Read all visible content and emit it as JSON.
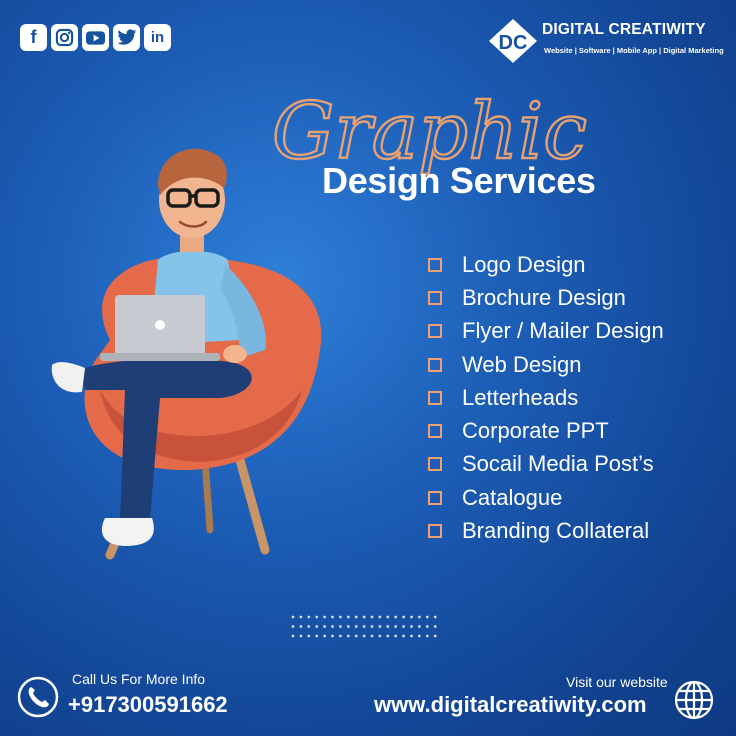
{
  "socials": [
    {
      "icon": "facebook-icon",
      "glyph": "f"
    },
    {
      "icon": "instagram-icon",
      "glyph": ""
    },
    {
      "icon": "youtube-icon",
      "glyph": ""
    },
    {
      "icon": "twitter-icon",
      "glyph": ""
    },
    {
      "icon": "linkedin-icon",
      "glyph": "in"
    }
  ],
  "logo": {
    "mark": "DC",
    "name": "DIGITAL CREATIWITY",
    "tagline": "Website | Software | Mobile App | Digital Marketing"
  },
  "headline": {
    "script": "Graphic",
    "main": "Design Services"
  },
  "services": [
    "Logo Design",
    "Brochure Design",
    "Flyer / Mailer Design",
    "Web Design",
    "Letterheads",
    "Corporate PPT",
    "Socail Media Post’s",
    "Catalogue",
    "Branding Collateral"
  ],
  "contact": {
    "call_label": "Call Us For More Info",
    "phone": "+917300591662",
    "visit_label": "Visit our website",
    "website": "www.digitalcreatiwity.com"
  },
  "colors": {
    "background": "#1d5fb8",
    "accent": "#e8a170",
    "text": "#ffffff"
  }
}
